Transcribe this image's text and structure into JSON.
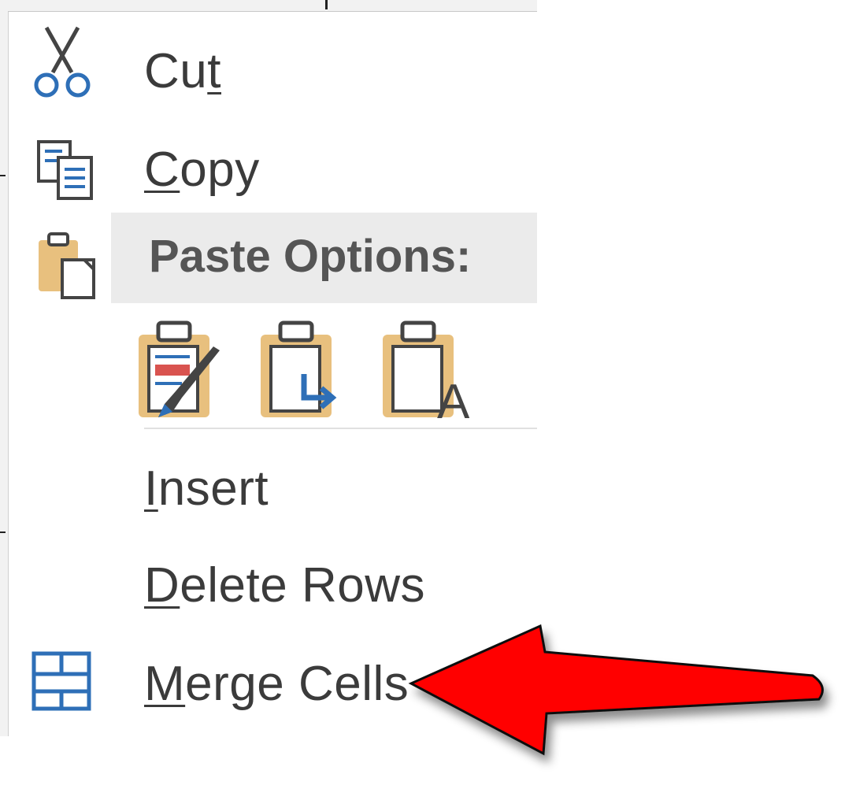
{
  "context_menu": {
    "items": [
      {
        "label": "Cut",
        "accel_before": "Cu",
        "accel_char": "t",
        "accel_after": "",
        "icon": "scissors-icon"
      },
      {
        "label": "Copy",
        "accel_before": "",
        "accel_char": "C",
        "accel_after": "opy",
        "icon": "copy-icon"
      },
      {
        "label": "Insert",
        "accel_before": "",
        "accel_char": "I",
        "accel_after": "nsert",
        "icon": ""
      },
      {
        "label": "Delete Rows",
        "accel_before": "",
        "accel_char": "D",
        "accel_after": "elete Rows",
        "icon": ""
      },
      {
        "label": "Merge Cells",
        "accel_before": "",
        "accel_char": "M",
        "accel_after": "erge Cells",
        "icon": "merge-cells-icon"
      }
    ],
    "paste_options": {
      "label": "Paste Options:",
      "icon": "clipboard-icon",
      "options": [
        {
          "name": "keep-source-formatting",
          "icon": "paste-keep-formatting-icon"
        },
        {
          "name": "merge-formatting",
          "icon": "paste-merge-formatting-icon"
        },
        {
          "name": "keep-text-only",
          "icon": "paste-text-only-icon",
          "glyph": "A"
        }
      ]
    }
  },
  "annotation": {
    "arrow_color": "#ff0000",
    "points_to": "Merge Cells"
  },
  "colors": {
    "accent_blue": "#2e6fb7",
    "clipboard_tan": "#e8c07e",
    "text": "#3b3b3b",
    "hover_bg": "#ebebeb"
  }
}
